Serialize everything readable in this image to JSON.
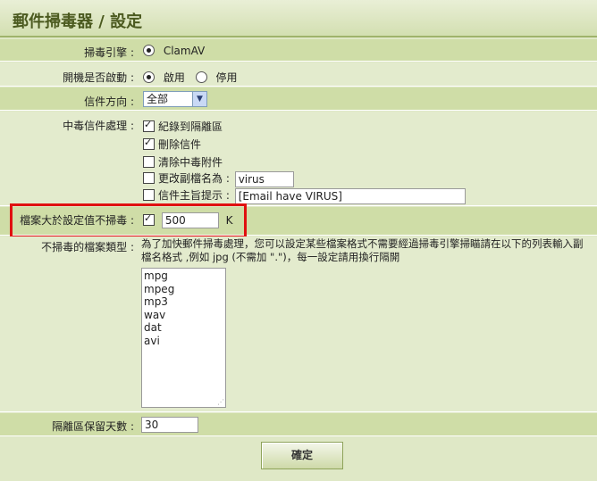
{
  "header": {
    "title": "郵件掃毒器 / 設定"
  },
  "engine": {
    "label": "掃毒引擎 :",
    "option": "ClamAV"
  },
  "boot": {
    "label": "開機是否啟動 :",
    "on": "啟用",
    "off": "停用"
  },
  "direction": {
    "label": "信件方向 :",
    "selected": "全部"
  },
  "infected": {
    "label": "中毒信件處理 :",
    "log": "紀錄到隔離區",
    "delete": "刪除信件",
    "clear": "清除中毒附件",
    "rename": "更改副檔名為 :",
    "rename_value": "virus",
    "subject": "信件主旨提示 :",
    "subject_value": "[Email have VIRUS]"
  },
  "size_limit": {
    "label": "檔案大於設定值不掃毒 :",
    "value": "500",
    "unit": "K"
  },
  "skip_types": {
    "label": "不掃毒的檔案類型 :",
    "description": "為了加快郵件掃毒處理，您可以設定某些檔案格式不需要經過掃毒引擎掃瞄請在以下的列表輸入副檔名格式 ,例如 jpg (不需加 \".\")，每一設定請用換行隔開",
    "items": [
      "mpg",
      "mpeg",
      "mp3",
      "wav",
      "dat",
      "avi"
    ]
  },
  "quarantine": {
    "label": "隔離區保留天數 :",
    "value": "30"
  },
  "submit": {
    "label": "確定"
  }
}
